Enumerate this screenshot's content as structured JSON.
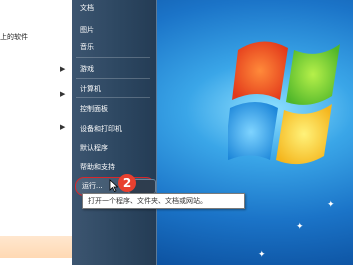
{
  "left_pane": {
    "items": [
      {
        "label": "上的软件",
        "has_arrow": false
      },
      {
        "label": "",
        "has_arrow": true
      },
      {
        "label": "",
        "has_arrow": true
      },
      {
        "label": "",
        "has_arrow": true
      }
    ]
  },
  "right_pane": {
    "items": [
      {
        "label": "文档",
        "has_arrow": false
      },
      {
        "label": "图片",
        "has_arrow": false
      },
      {
        "label": "音乐",
        "has_arrow": false
      },
      {
        "label": "游戏",
        "has_arrow": false
      },
      {
        "label": "计算机",
        "has_arrow": false
      },
      {
        "label": "控制面板",
        "has_arrow": false
      },
      {
        "label": "设备和打印机",
        "has_arrow": false
      },
      {
        "label": "默认程序",
        "has_arrow": false
      },
      {
        "label": "帮助和支持",
        "has_arrow": false
      }
    ],
    "run": {
      "label": "运行..."
    }
  },
  "annotation": {
    "step_number": "2",
    "color": "#e8402f"
  },
  "tooltip": {
    "text": "打开一个程序、文件夹、文档或网站。"
  },
  "colors": {
    "menu_right": "#2c4660",
    "highlight": "#d8262a",
    "desktop": "#1b74c8"
  }
}
